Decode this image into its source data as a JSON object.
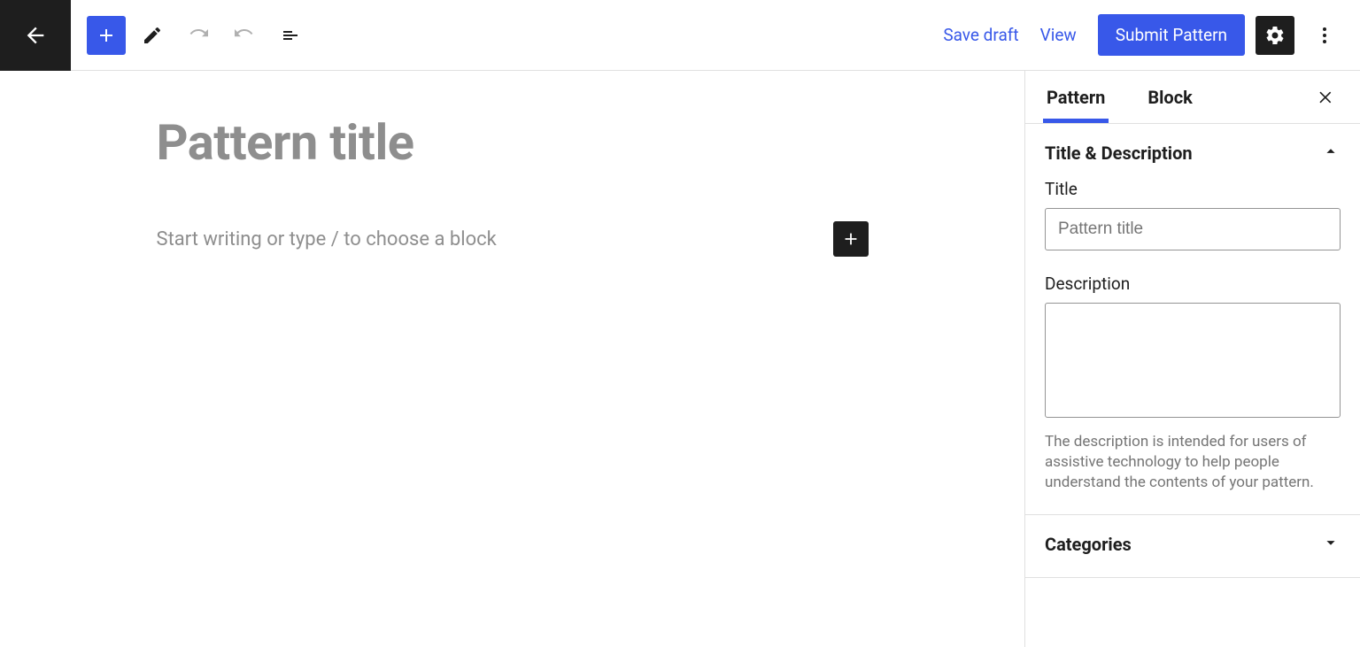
{
  "toolbar": {
    "save_draft": "Save draft",
    "view": "View",
    "submit": "Submit Pattern"
  },
  "canvas": {
    "title_placeholder": "Pattern title",
    "block_placeholder": "Start writing or type / to choose a block"
  },
  "sidebar": {
    "tabs": {
      "pattern": "Pattern",
      "block": "Block"
    },
    "panels": {
      "title_desc": {
        "title": "Title & Description",
        "title_field_label": "Title",
        "title_field_placeholder": "Pattern title",
        "description_field_label": "Description",
        "description_help": "The description is intended for users of assistive technology to help people understand the contents of your pattern."
      },
      "categories": {
        "title": "Categories"
      }
    }
  }
}
